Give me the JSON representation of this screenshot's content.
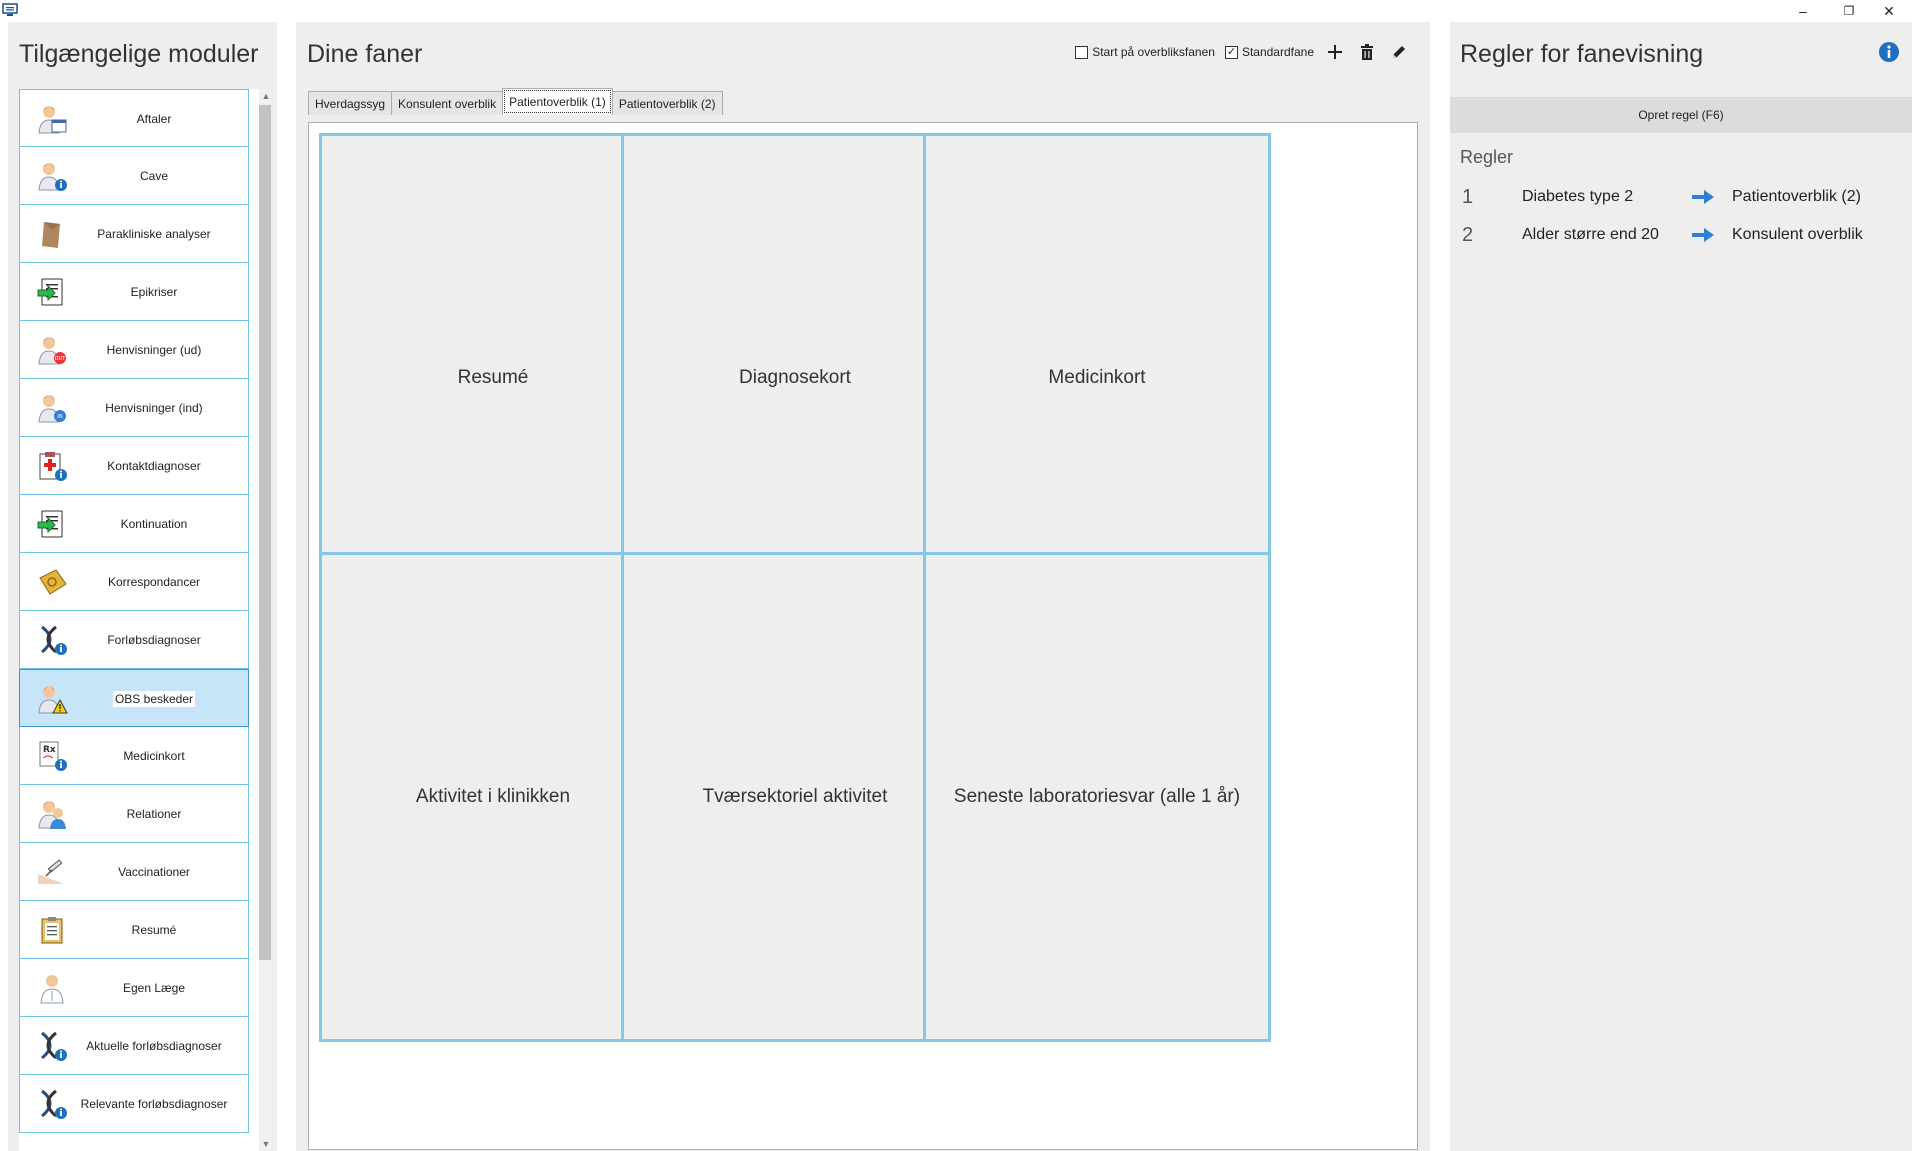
{
  "window": {
    "minimize": "–",
    "restore": "❐",
    "close": "✕"
  },
  "left": {
    "title": "Tilgængelige moduler",
    "modules": [
      {
        "label": "Aftaler",
        "icon": "person-calendar-icon"
      },
      {
        "label": "Cave",
        "icon": "person-info-icon"
      },
      {
        "label": "Parakliniske analyser",
        "icon": "envelope-icon"
      },
      {
        "label": "Epikriser",
        "icon": "document-arrow-icon"
      },
      {
        "label": "Henvisninger (ud)",
        "icon": "person-out-icon"
      },
      {
        "label": "Henvisninger (ind)",
        "icon": "person-in-icon"
      },
      {
        "label": "Kontaktdiagnoser",
        "icon": "clipboard-cross-icon"
      },
      {
        "label": "Kontinuation",
        "icon": "document-arrow-icon"
      },
      {
        "label": "Korrespondancer",
        "icon": "mail-book-icon"
      },
      {
        "label": "Forløbsdiagnoser",
        "icon": "dna-info-icon"
      },
      {
        "label": "OBS beskeder",
        "icon": "person-warning-icon",
        "selected": true
      },
      {
        "label": "Medicinkort",
        "icon": "prescription-info-icon"
      },
      {
        "label": "Relationer",
        "icon": "people-icon"
      },
      {
        "label": "Vaccinationer",
        "icon": "syringe-icon"
      },
      {
        "label": "Resumé",
        "icon": "clipboard-icon"
      },
      {
        "label": "Egen Læge",
        "icon": "doctor-icon"
      },
      {
        "label": "Aktuelle forløbsdiagnoser",
        "icon": "dna-info-icon"
      },
      {
        "label": "Relevante forløbsdiagnoser",
        "icon": "dna-info-icon"
      }
    ]
  },
  "middle": {
    "title": "Dine faner",
    "start_overview_label": "Start på overbliksfanen",
    "start_overview_checked": false,
    "default_tab_label": "Standardfane",
    "default_tab_checked": true,
    "check_mark": "✓",
    "tabs": [
      {
        "label": "Hverdagssyg"
      },
      {
        "label": "Konsulent overblik"
      },
      {
        "label": "Patientoverblik (1)",
        "active": true
      },
      {
        "label": "Patientoverblik (2)"
      }
    ],
    "slots": [
      "Resumé",
      "Diagnosekort",
      "Medicinkort",
      "Aktivitet i klinikken",
      "Tværsektoriel aktivitet",
      "Seneste laboratoriesvar (alle 1 år)"
    ]
  },
  "right": {
    "title": "Regler for fanevisning",
    "create_rule_label": "Opret regel (F6)",
    "rules_heading": "Regler",
    "rules": [
      {
        "num": "1",
        "condition": "Diabetes type 2",
        "target": "Patientoverblik (2)"
      },
      {
        "num": "2",
        "condition": "Alder større end 20",
        "target": "Konsulent overblik"
      }
    ]
  },
  "colors": {
    "accent": "#84c8e6",
    "selected_bg": "#c6e5f8",
    "info_blue": "#1f6fc1",
    "arrow_blue": "#2f7fd3"
  }
}
